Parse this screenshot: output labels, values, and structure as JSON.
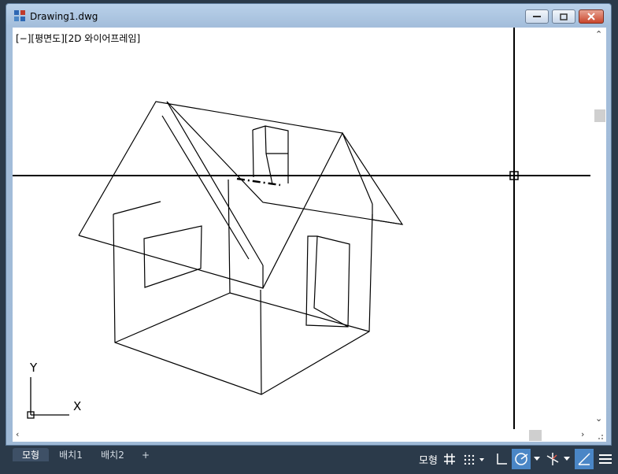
{
  "window": {
    "title": "Drawing1.dwg"
  },
  "viewport": {
    "label": "[−][평면도][2D 와이어프레임]"
  },
  "ucs": {
    "x_label": "X",
    "y_label": "Y"
  },
  "tabs": [
    {
      "label": "모형",
      "active": true
    },
    {
      "label": "배치1",
      "active": false
    },
    {
      "label": "배치2",
      "active": false
    },
    {
      "label": "+",
      "active": false
    }
  ],
  "statusbar": {
    "model_label": "모형"
  },
  "colors": {
    "accent": "#4a86c6",
    "close": "#c9462c"
  }
}
